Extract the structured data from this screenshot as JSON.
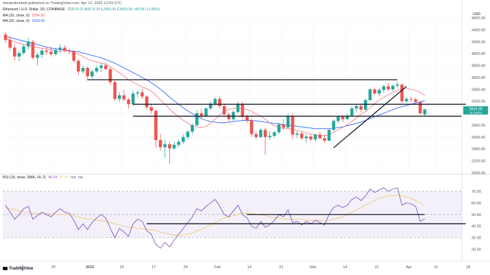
{
  "header": {
    "published_by": "elimandombell published on TradingView.com, Apr 12, 2022 12:43 UTC",
    "symbol": "Ethereum / U.S. Dollar, 1D, COINBASE",
    "o_label": "O",
    "o_value": "3079.32",
    "h_label": "H",
    "h_value": "3074.34",
    "l_label": "L",
    "l_value": "2950.35",
    "c_label": "C",
    "c_value": "3064.39",
    "change": "+84.86 (+2.85%)",
    "ma10_label": "MA (10, close, 0)",
    "ma10_value": "3294.90",
    "ma25_label": "MA (25, close, 0)",
    "ma25_value": "3209.09",
    "currency": "USD"
  },
  "rsi_legend": {
    "label": "RSI (14, close, SMA, 14, 2)",
    "rsi_value": "46.24",
    "ma_value": "57.42",
    "na1": "n/a",
    "na2": "n/a"
  },
  "price_tag": {
    "price": "3064.39",
    "countdown": "11:16:03"
  },
  "footer": {
    "logo": "TradingView"
  },
  "colors": {
    "up": "#26a69a",
    "down": "#ef5350",
    "ma10": "#f77c80",
    "ma25": "#2962ff",
    "rsi": "#7e57c2",
    "rsi_ma": "#f5c26b",
    "band": "#7e57c2",
    "trend": "#131722"
  },
  "chart_data": [
    {
      "type": "candlestick",
      "title": "Ethereum / U.S. Dollar, 1D, COINBASE",
      "ylim": [
        2000,
        4600
      ],
      "y_ticks": [
        4600,
        4400,
        4200,
        4000,
        3800,
        3600,
        3400,
        3200,
        3000,
        2800,
        2600,
        2400,
        2200,
        2000
      ],
      "x_ticks": [
        "13",
        "20",
        "2022",
        "10",
        "17",
        "24",
        "Feb",
        "14",
        "21",
        "Mar",
        "14",
        "21",
        "Apr",
        "11",
        "18"
      ],
      "candles_ohlc": [
        [
          4320,
          4360,
          4180,
          4230
        ],
        [
          4230,
          4290,
          4050,
          4100
        ],
        [
          4100,
          4150,
          3880,
          3950
        ],
        [
          3950,
          4050,
          3870,
          4010
        ],
        [
          4010,
          4150,
          3980,
          4120
        ],
        [
          4120,
          4260,
          4060,
          4200
        ],
        [
          4200,
          4230,
          3900,
          3930
        ],
        [
          3930,
          4020,
          3800,
          3980
        ],
        [
          3980,
          4080,
          3930,
          4050
        ],
        [
          4050,
          4110,
          3980,
          4030
        ],
        [
          4030,
          4120,
          3950,
          3990
        ],
        [
          3990,
          4100,
          3960,
          4060
        ],
        [
          4060,
          4150,
          4010,
          4100
        ],
        [
          4100,
          4140,
          4020,
          4050
        ],
        [
          4050,
          4090,
          3990,
          4040
        ],
        [
          4040,
          4060,
          3850,
          3880
        ],
        [
          3880,
          3900,
          3650,
          3700
        ],
        [
          3700,
          3800,
          3660,
          3760
        ],
        [
          3760,
          3790,
          3550,
          3620
        ],
        [
          3620,
          3730,
          3580,
          3700
        ],
        [
          3700,
          3800,
          3670,
          3760
        ],
        [
          3760,
          3840,
          3690,
          3800
        ],
        [
          3800,
          3850,
          3720,
          3740
        ],
        [
          3740,
          3770,
          3470,
          3520
        ],
        [
          3520,
          3560,
          3210,
          3240
        ],
        [
          3240,
          3350,
          3190,
          3300
        ],
        [
          3300,
          3390,
          3200,
          3230
        ],
        [
          3230,
          3260,
          3080,
          3150
        ],
        [
          3150,
          3380,
          3120,
          3330
        ],
        [
          3330,
          3390,
          3270,
          3350
        ],
        [
          3350,
          3410,
          3240,
          3280
        ],
        [
          3280,
          3300,
          3060,
          3100
        ],
        [
          3100,
          3150,
          2990,
          3040
        ],
        [
          3040,
          3060,
          2420,
          2550
        ],
        [
          2550,
          2650,
          2370,
          2430
        ],
        [
          2430,
          2560,
          2250,
          2480
        ],
        [
          2480,
          2520,
          2150,
          2410
        ],
        [
          2410,
          2520,
          2380,
          2470
        ],
        [
          2470,
          2560,
          2430,
          2520
        ],
        [
          2520,
          2640,
          2490,
          2600
        ],
        [
          2600,
          2720,
          2560,
          2690
        ],
        [
          2690,
          2830,
          2650,
          2800
        ],
        [
          2800,
          3050,
          2780,
          3000
        ],
        [
          3000,
          3080,
          2900,
          2950
        ],
        [
          2950,
          3100,
          2930,
          3080
        ],
        [
          3080,
          3200,
          3050,
          3160
        ],
        [
          3160,
          3270,
          3120,
          3240
        ],
        [
          3240,
          3280,
          3080,
          3120
        ],
        [
          3120,
          3160,
          2950,
          2980
        ],
        [
          2980,
          3010,
          2860,
          2900
        ],
        [
          2900,
          3050,
          2870,
          3020
        ],
        [
          3020,
          3190,
          3000,
          3160
        ],
        [
          3160,
          3190,
          2900,
          2940
        ],
        [
          2940,
          2980,
          2840,
          2880
        ],
        [
          2880,
          2920,
          2600,
          2650
        ],
        [
          2650,
          2700,
          2560,
          2600
        ],
        [
          2600,
          2750,
          2580,
          2720
        ],
        [
          2720,
          2760,
          2300,
          2600
        ],
        [
          2600,
          2700,
          2550,
          2620
        ],
        [
          2620,
          2700,
          2590,
          2680
        ],
        [
          2680,
          2840,
          2650,
          2810
        ],
        [
          2810,
          2900,
          2720,
          2760
        ],
        [
          2760,
          2990,
          2740,
          2950
        ],
        [
          2950,
          3000,
          2560,
          2640
        ],
        [
          2640,
          2700,
          2580,
          2660
        ],
        [
          2660,
          2700,
          2550,
          2580
        ],
        [
          2580,
          2650,
          2500,
          2610
        ],
        [
          2610,
          2640,
          2540,
          2560
        ],
        [
          2560,
          2660,
          2520,
          2640
        ],
        [
          2640,
          2690,
          2560,
          2580
        ],
        [
          2580,
          2640,
          2500,
          2540
        ],
        [
          2540,
          2740,
          2530,
          2720
        ],
        [
          2720,
          2900,
          2700,
          2870
        ],
        [
          2870,
          2960,
          2830,
          2940
        ],
        [
          2940,
          2960,
          2850,
          2900
        ],
        [
          2900,
          3000,
          2880,
          2960
        ],
        [
          2960,
          3120,
          2940,
          3080
        ],
        [
          3080,
          3150,
          3020,
          3120
        ],
        [
          3120,
          3160,
          3020,
          3060
        ],
        [
          3060,
          3250,
          3040,
          3220
        ],
        [
          3220,
          3420,
          3200,
          3400
        ],
        [
          3400,
          3430,
          3300,
          3330
        ],
        [
          3330,
          3420,
          3280,
          3390
        ],
        [
          3390,
          3480,
          3340,
          3450
        ],
        [
          3450,
          3500,
          3380,
          3400
        ],
        [
          3400,
          3480,
          3370,
          3460
        ],
        [
          3460,
          3530,
          3410,
          3480
        ],
        [
          3480,
          3500,
          3170,
          3200
        ],
        [
          3200,
          3270,
          3180,
          3240
        ],
        [
          3240,
          3280,
          3180,
          3230
        ],
        [
          3230,
          3260,
          3160,
          3190
        ],
        [
          3190,
          3200,
          2970,
          3000
        ],
        [
          2980,
          3074,
          2950,
          3064
        ]
      ],
      "ma10": [
        4250,
        4230,
        4200,
        4170,
        4150,
        4140,
        4120,
        4100,
        4090,
        4080,
        4060,
        4040,
        4040,
        4050,
        4040,
        4020,
        3990,
        3950,
        3910,
        3880,
        3860,
        3840,
        3820,
        3780,
        3730,
        3680,
        3620,
        3560,
        3520,
        3480,
        3440,
        3410,
        3370,
        3300,
        3220,
        3150,
        3070,
        3000,
        2940,
        2880,
        2830,
        2790,
        2770,
        2760,
        2780,
        2830,
        2900,
        2970,
        3030,
        3060,
        3080,
        3090,
        3080,
        3060,
        3030,
        2990,
        2950,
        2900,
        2840,
        2790,
        2760,
        2740,
        2740,
        2730,
        2710,
        2690,
        2670,
        2650,
        2640,
        2630,
        2620,
        2640,
        2680,
        2720,
        2760,
        2810,
        2860,
        2920,
        2980,
        3030,
        3090,
        3160,
        3220,
        3270,
        3310,
        3350,
        3380,
        3410,
        3420,
        3400,
        3380,
        3350,
        3294.9
      ],
      "ma25": [
        4290,
        4270,
        4250,
        4230,
        4210,
        4190,
        4170,
        4150,
        4130,
        4110,
        4090,
        4080,
        4070,
        4060,
        4050,
        4040,
        4030,
        4010,
        3990,
        3970,
        3950,
        3930,
        3900,
        3870,
        3840,
        3800,
        3760,
        3720,
        3680,
        3640,
        3600,
        3560,
        3510,
        3460,
        3400,
        3340,
        3270,
        3210,
        3150,
        3090,
        3040,
        2990,
        2950,
        2910,
        2880,
        2860,
        2850,
        2840,
        2840,
        2850,
        2860,
        2870,
        2880,
        2880,
        2880,
        2870,
        2860,
        2850,
        2840,
        2830,
        2820,
        2810,
        2800,
        2790,
        2780,
        2770,
        2760,
        2750,
        2740,
        2740,
        2740,
        2740,
        2750,
        2760,
        2770,
        2790,
        2810,
        2830,
        2850,
        2880,
        2910,
        2940,
        2970,
        3000,
        3030,
        3060,
        3090,
        3110,
        3130,
        3150,
        3170,
        3190,
        3209.09
      ],
      "horizontal_levels": [
        3560,
        3150,
        2950
      ],
      "trendline": [
        [
          2420,
          3450
        ]
      ]
    },
    {
      "type": "line",
      "title": "RSI (14, close, SMA, 14, 2)",
      "ylim": [
        15,
        80
      ],
      "y_ticks": [
        70,
        60,
        50,
        40,
        30,
        20
      ],
      "band": [
        30,
        70
      ],
      "rsi": [
        58,
        52,
        46,
        50,
        55,
        57,
        46,
        49,
        52,
        50,
        48,
        52,
        55,
        52,
        51,
        45,
        37,
        42,
        37,
        43,
        47,
        50,
        47,
        38,
        30,
        38,
        35,
        31,
        42,
        46,
        44,
        36,
        33,
        24,
        21,
        26,
        22,
        28,
        33,
        38,
        43,
        48,
        55,
        53,
        57,
        60,
        63,
        57,
        50,
        48,
        53,
        58,
        50,
        47,
        40,
        38,
        44,
        39,
        41,
        45,
        50,
        48,
        54,
        43,
        44,
        41,
        44,
        42,
        45,
        43,
        41,
        50,
        56,
        58,
        56,
        58,
        63,
        65,
        62,
        66,
        72,
        69,
        71,
        73,
        70,
        72,
        73,
        58,
        60,
        59,
        57,
        44,
        46.24
      ],
      "rsi_ma": [
        56,
        55,
        54,
        53,
        52,
        52,
        51,
        51,
        51,
        51,
        50,
        50,
        50,
        50,
        50,
        49,
        48,
        47,
        46,
        46,
        45,
        45,
        44,
        43,
        42,
        41,
        40,
        39,
        39,
        38,
        38,
        37,
        37,
        36,
        35,
        34,
        33,
        32,
        32,
        32,
        33,
        34,
        36,
        37,
        39,
        41,
        43,
        45,
        47,
        48,
        49,
        50,
        51,
        51,
        51,
        50,
        50,
        49,
        48,
        47,
        47,
        46,
        46,
        46,
        46,
        46,
        45,
        45,
        45,
        45,
        44,
        45,
        46,
        47,
        48,
        50,
        52,
        54,
        56,
        58,
        60,
        62,
        64,
        65,
        66,
        66,
        67,
        66,
        65,
        64,
        62,
        60,
        57.42
      ],
      "levels": [
        50,
        42
      ]
    }
  ]
}
